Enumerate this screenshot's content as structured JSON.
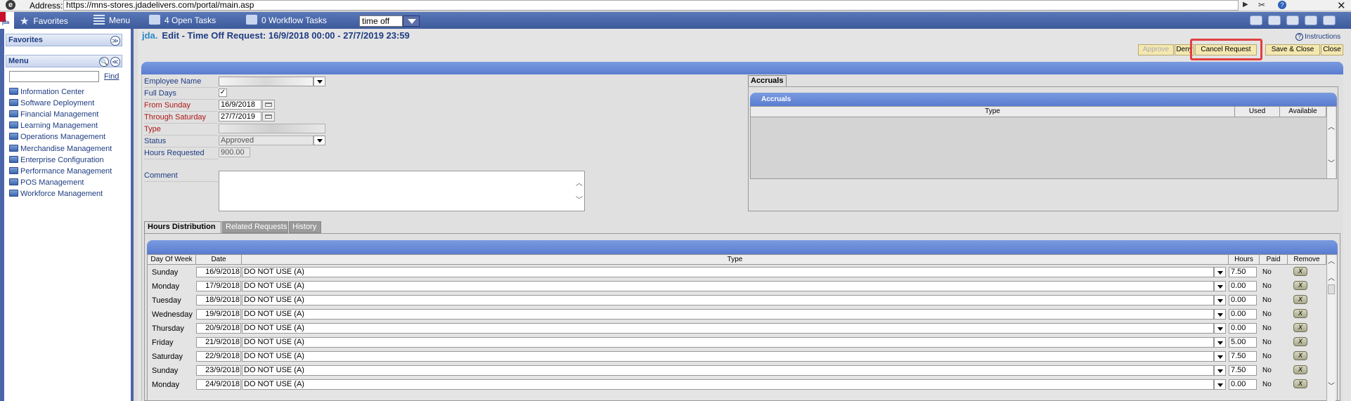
{
  "address_bar": {
    "label": "Address:",
    "url": "https://mns-stores.jdadelivers.com/portal/main.asp"
  },
  "toolbar": {
    "favorites": "Favorites",
    "menu": "Menu",
    "open_tasks": "4 Open Tasks",
    "workflow_tasks": "0 Workflow Tasks",
    "search_value": "time off"
  },
  "sidebar": {
    "favorites_title": "Favorites",
    "menu_title": "Menu",
    "find_label": "Find",
    "items": [
      "Information Center",
      "Software Deployment",
      "Financial Management",
      "Learning Management",
      "Operations Management",
      "Merchandise Management",
      "Enterprise Configuration",
      "Performance Management",
      "POS Management",
      "Workforce Management"
    ]
  },
  "page": {
    "logo": "jda.",
    "title": "Edit - Time Off Request: 16/9/2018 00:00 - 27/7/2019 23:59",
    "instructions": "Instructions"
  },
  "actions": {
    "approve": "Approve",
    "deny": "Deny",
    "cancel_request": "Cancel Request",
    "save_close": "Save & Close",
    "close": "Close"
  },
  "form": {
    "employee_name_label": "Employee Name",
    "full_days_label": "Full Days",
    "from_label": "From Sunday",
    "from_value": "16/9/2018",
    "through_label": "Through Saturday",
    "through_value": "27/7/2019",
    "type_label": "Type",
    "status_label": "Status",
    "status_value": "Approved",
    "hours_requested_label": "Hours Requested",
    "hours_requested_value": "900.00",
    "comment_label": "Comment"
  },
  "accruals": {
    "tab": "Accruals",
    "header": "Accruals",
    "columns": [
      "Type",
      "Used",
      "Available"
    ]
  },
  "hours_distribution": {
    "tabs": [
      "Hours Distribution",
      "Related Requests",
      "History"
    ],
    "columns": [
      "Day Of Week",
      "Date",
      "Type",
      "Hours",
      "Paid",
      "Remove"
    ],
    "remove_symbol": "X",
    "rows": [
      {
        "day": "Sunday",
        "date": "16/9/2018",
        "type": "DO NOT USE (A)",
        "hours": "7.50",
        "paid": "No"
      },
      {
        "day": "Monday",
        "date": "17/9/2018",
        "type": "DO NOT USE (A)",
        "hours": "0.00",
        "paid": "No"
      },
      {
        "day": "Tuesday",
        "date": "18/9/2018",
        "type": "DO NOT USE (A)",
        "hours": "0.00",
        "paid": "No"
      },
      {
        "day": "Wednesday",
        "date": "19/9/2018",
        "type": "DO NOT USE (A)",
        "hours": "0.00",
        "paid": "No"
      },
      {
        "day": "Thursday",
        "date": "20/9/2018",
        "type": "DO NOT USE (A)",
        "hours": "0.00",
        "paid": "No"
      },
      {
        "day": "Friday",
        "date": "21/9/2018",
        "type": "DO NOT USE (A)",
        "hours": "5.00",
        "paid": "No"
      },
      {
        "day": "Saturday",
        "date": "22/9/2018",
        "type": "DO NOT USE (A)",
        "hours": "7.50",
        "paid": "No"
      },
      {
        "day": "Sunday",
        "date": "23/9/2018",
        "type": "DO NOT USE (A)",
        "hours": "7.50",
        "paid": "No"
      },
      {
        "day": "Monday",
        "date": "24/9/2018",
        "type": "DO NOT USE (A)",
        "hours": "0.00",
        "paid": "No"
      }
    ]
  }
}
